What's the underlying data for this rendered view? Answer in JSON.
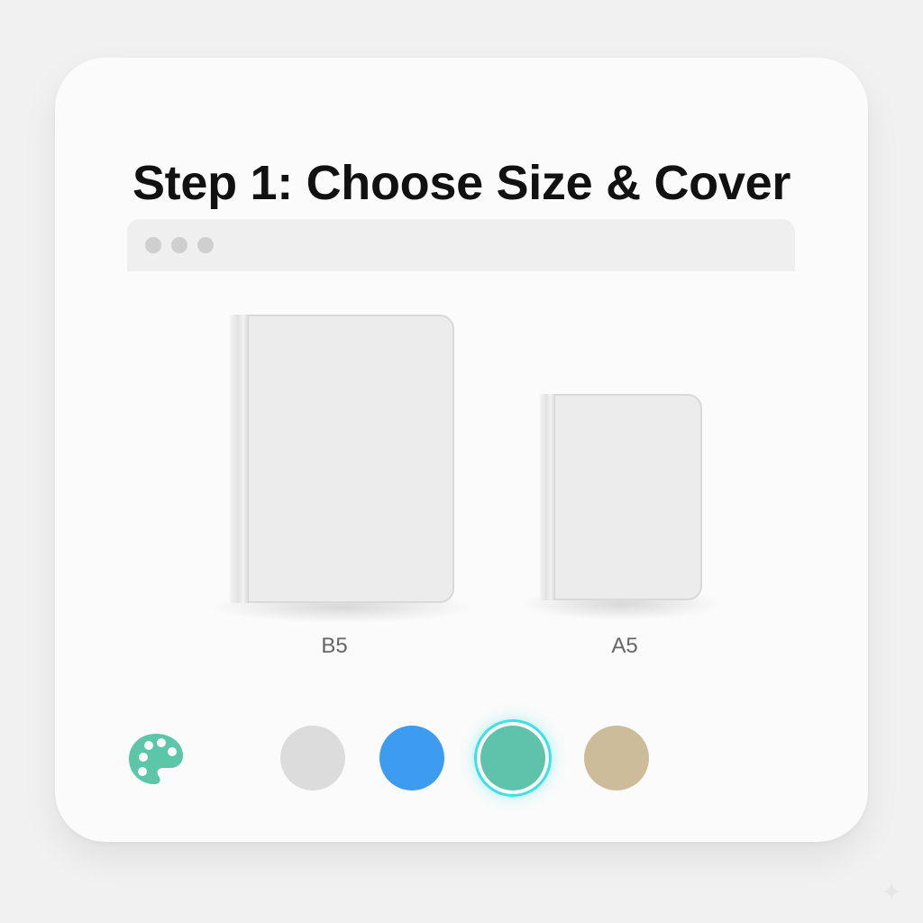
{
  "title": "Step 1: Choose Size & Cover",
  "sizes": [
    {
      "label": "B5"
    },
    {
      "label": "A5"
    }
  ],
  "palette": {
    "icon": "palette-icon",
    "color": "#5cc7a8"
  },
  "swatches": [
    {
      "name": "light-gray",
      "color": "#dcdcdd",
      "selected": false
    },
    {
      "name": "blue",
      "color": "#3d9bf0",
      "selected": false
    },
    {
      "name": "teal",
      "color": "#5fc3ab",
      "selected": true
    },
    {
      "name": "beige",
      "color": "#cdbc9a",
      "selected": false
    }
  ]
}
